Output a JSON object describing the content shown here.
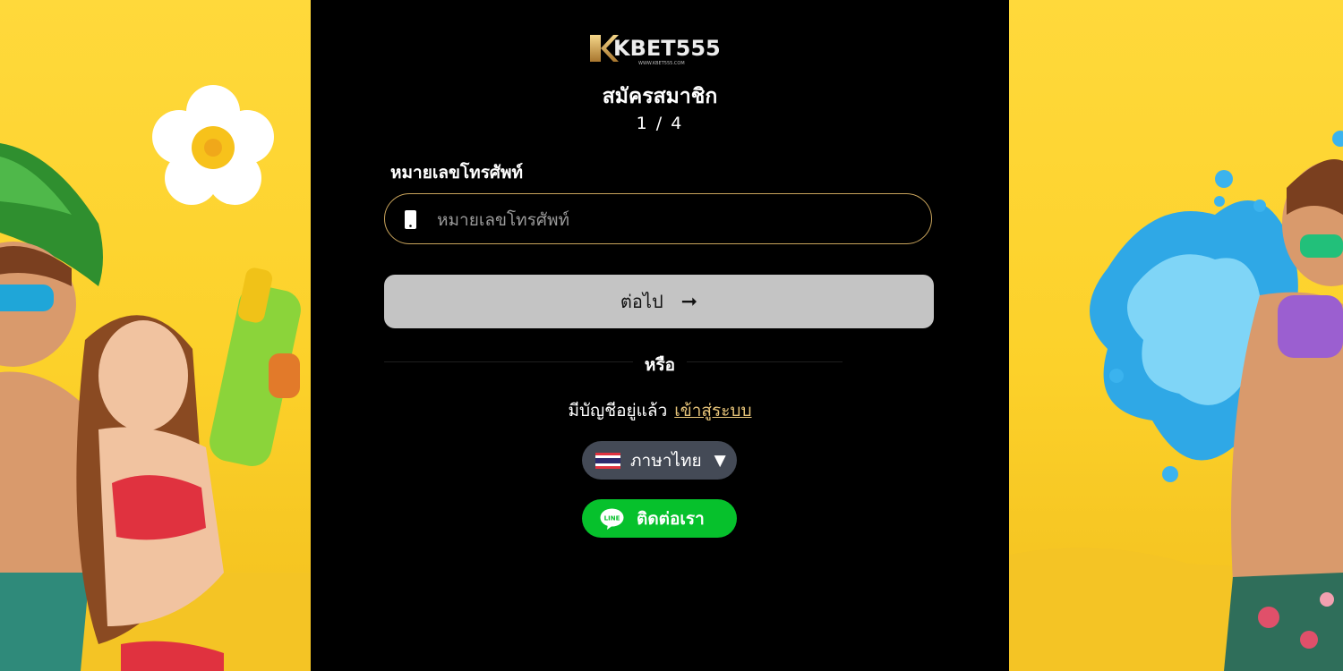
{
  "brand": {
    "logo_text": "KBET555",
    "logo_subtext": "WWW.KBET555.COM"
  },
  "register": {
    "title": "สมัครสมาชิก",
    "step": "1 / 4",
    "phone_label": "หมายเลขโทรศัพท์",
    "phone_placeholder": "หมายเลขโทรศัพท์",
    "phone_value": "",
    "next_label": "ต่อไป",
    "next_arrow": "➞",
    "or_text": "หรือ",
    "have_account_text": "มีบัญชีอยู่แล้ว",
    "login_link": "เข้าสู่ระบบ"
  },
  "language": {
    "selected": "ภาษาไทย",
    "caret": "▼",
    "flag_icon": "thai-flag-icon"
  },
  "contact": {
    "label": "ติดต่อเรา",
    "icon": "line-app-icon",
    "color": "#06c12c"
  },
  "colors": {
    "page_background": "#fcd12a",
    "panel_background": "#000000",
    "input_border": "#c9a45c",
    "next_button": "#c4c4c4",
    "login_link": "#e8c57a",
    "language_pill": "#444a56"
  }
}
